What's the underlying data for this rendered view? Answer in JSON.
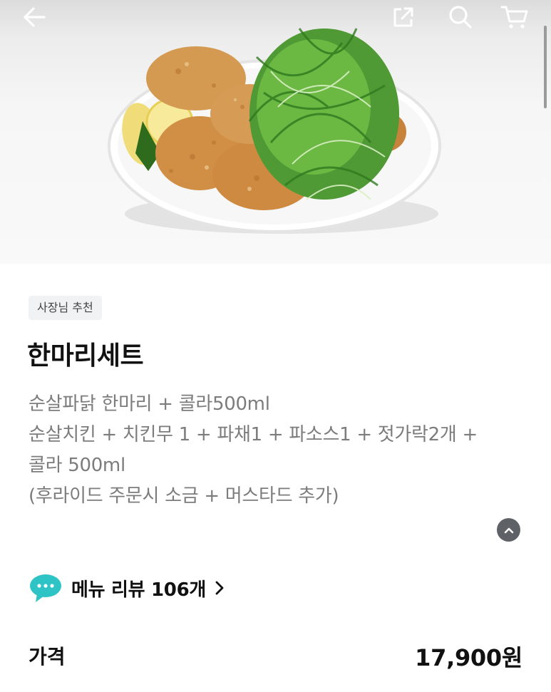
{
  "hero": {
    "image_icon": "fried-chicken-with-green-onion-photo"
  },
  "topbar": {
    "back_icon": "arrow-left-icon",
    "share_icon": "share-icon",
    "search_icon": "search-icon",
    "cart_icon": "cart-icon"
  },
  "menu": {
    "badge": "사장님 추천",
    "title": "한마리세트",
    "description_lines": [
      "순살파닭 한마리 + 콜라500ml",
      "순살치킨 + 치킨무 1 + 파채1 + 파소스1 + 젓가락2개 +",
      "콜라 500ml",
      "(후라이드 주문시 소금 + 머스타드 추가)"
    ]
  },
  "review": {
    "label": "메뉴 리뷰 106개",
    "icon": "chat-bubble-icon",
    "icon_color": "#2ec4c6"
  },
  "price": {
    "label": "가격",
    "value": "17,900원"
  },
  "colors": {
    "text_primary": "#111111",
    "text_secondary": "#7c7c7c",
    "badge_bg": "#f1f2f4",
    "collapse_btn": "#5e6165"
  }
}
